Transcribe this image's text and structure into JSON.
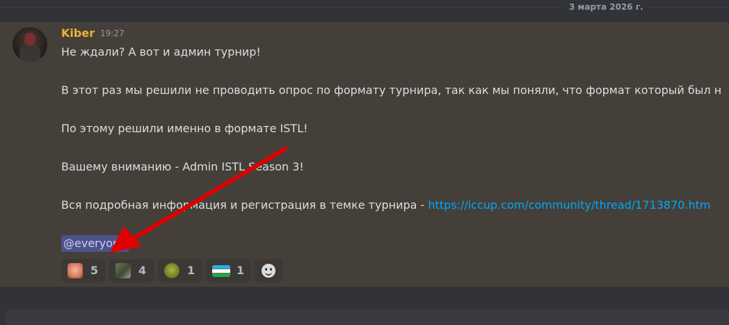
{
  "divider": {
    "date": "3 марта 2026 г."
  },
  "message": {
    "author": "Kiber",
    "time": "19:27",
    "lines": [
      "Не ждали? А вот и админ турнир!",
      "В этот раз мы решили не проводить опрос по формату турнира, так как мы поняли, что формат который был н",
      "По этому решили именно в формате ISTL!",
      "Вашему вниманию - Admin ISTL Season 3!",
      "Вся подробная информация и регистрация в темке турнира - "
    ],
    "link": "https://iccup.com/community/thread/1713870.htm",
    "mention": "@everyone"
  },
  "reactions": [
    {
      "emoji": "crying-face-emoji",
      "count": "5"
    },
    {
      "emoji": "soldier-gun-emoji",
      "count": "4"
    },
    {
      "emoji": "shrek-emoji",
      "count": "1"
    },
    {
      "emoji": "uzbekistan-flag-emoji",
      "count": "1"
    }
  ],
  "add_reaction_icon": "smiley-add-reaction-icon",
  "colors": {
    "username": "#f0b232",
    "link": "#00a8fc",
    "arrow": "#e00000",
    "mention_bg": "#4d5288"
  }
}
